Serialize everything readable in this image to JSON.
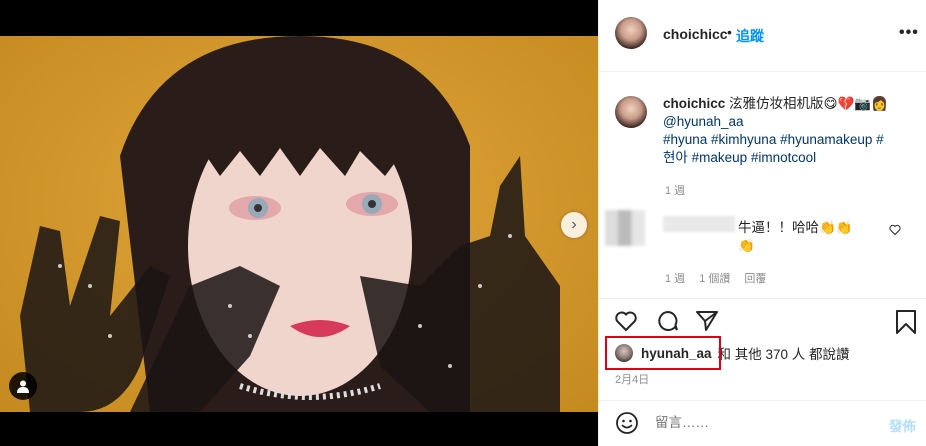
{
  "post": {
    "owner": "choichicc",
    "follow_label": "追蹤",
    "dot": "•",
    "more_label": "•••"
  },
  "caption": {
    "username": "choichicc",
    "text": "泫雅仿妆相机版😋💔📷👩",
    "mention": "@hyunah_aa",
    "tags_line1": "#hyuna #kimhyuna #hyunamakeup #",
    "tags_line2": "현아 #makeup #imnotcool",
    "time": "1 週"
  },
  "comment": {
    "text": "牛逼！！哈哈👏👏",
    "text2": "👏",
    "time": "1 週",
    "likes": "1 個讚",
    "reply": "回覆"
  },
  "likes": {
    "username": "hyunah_aa",
    "rest": "和 其他 370 人 都說讚",
    "date": "2月4日"
  },
  "add_comment": {
    "placeholder": "留言……",
    "post_label": "發佈"
  },
  "colors": {
    "accent": "#0095f6",
    "highlight_box": "#e0001a",
    "background_photo": "#d49a2f"
  }
}
